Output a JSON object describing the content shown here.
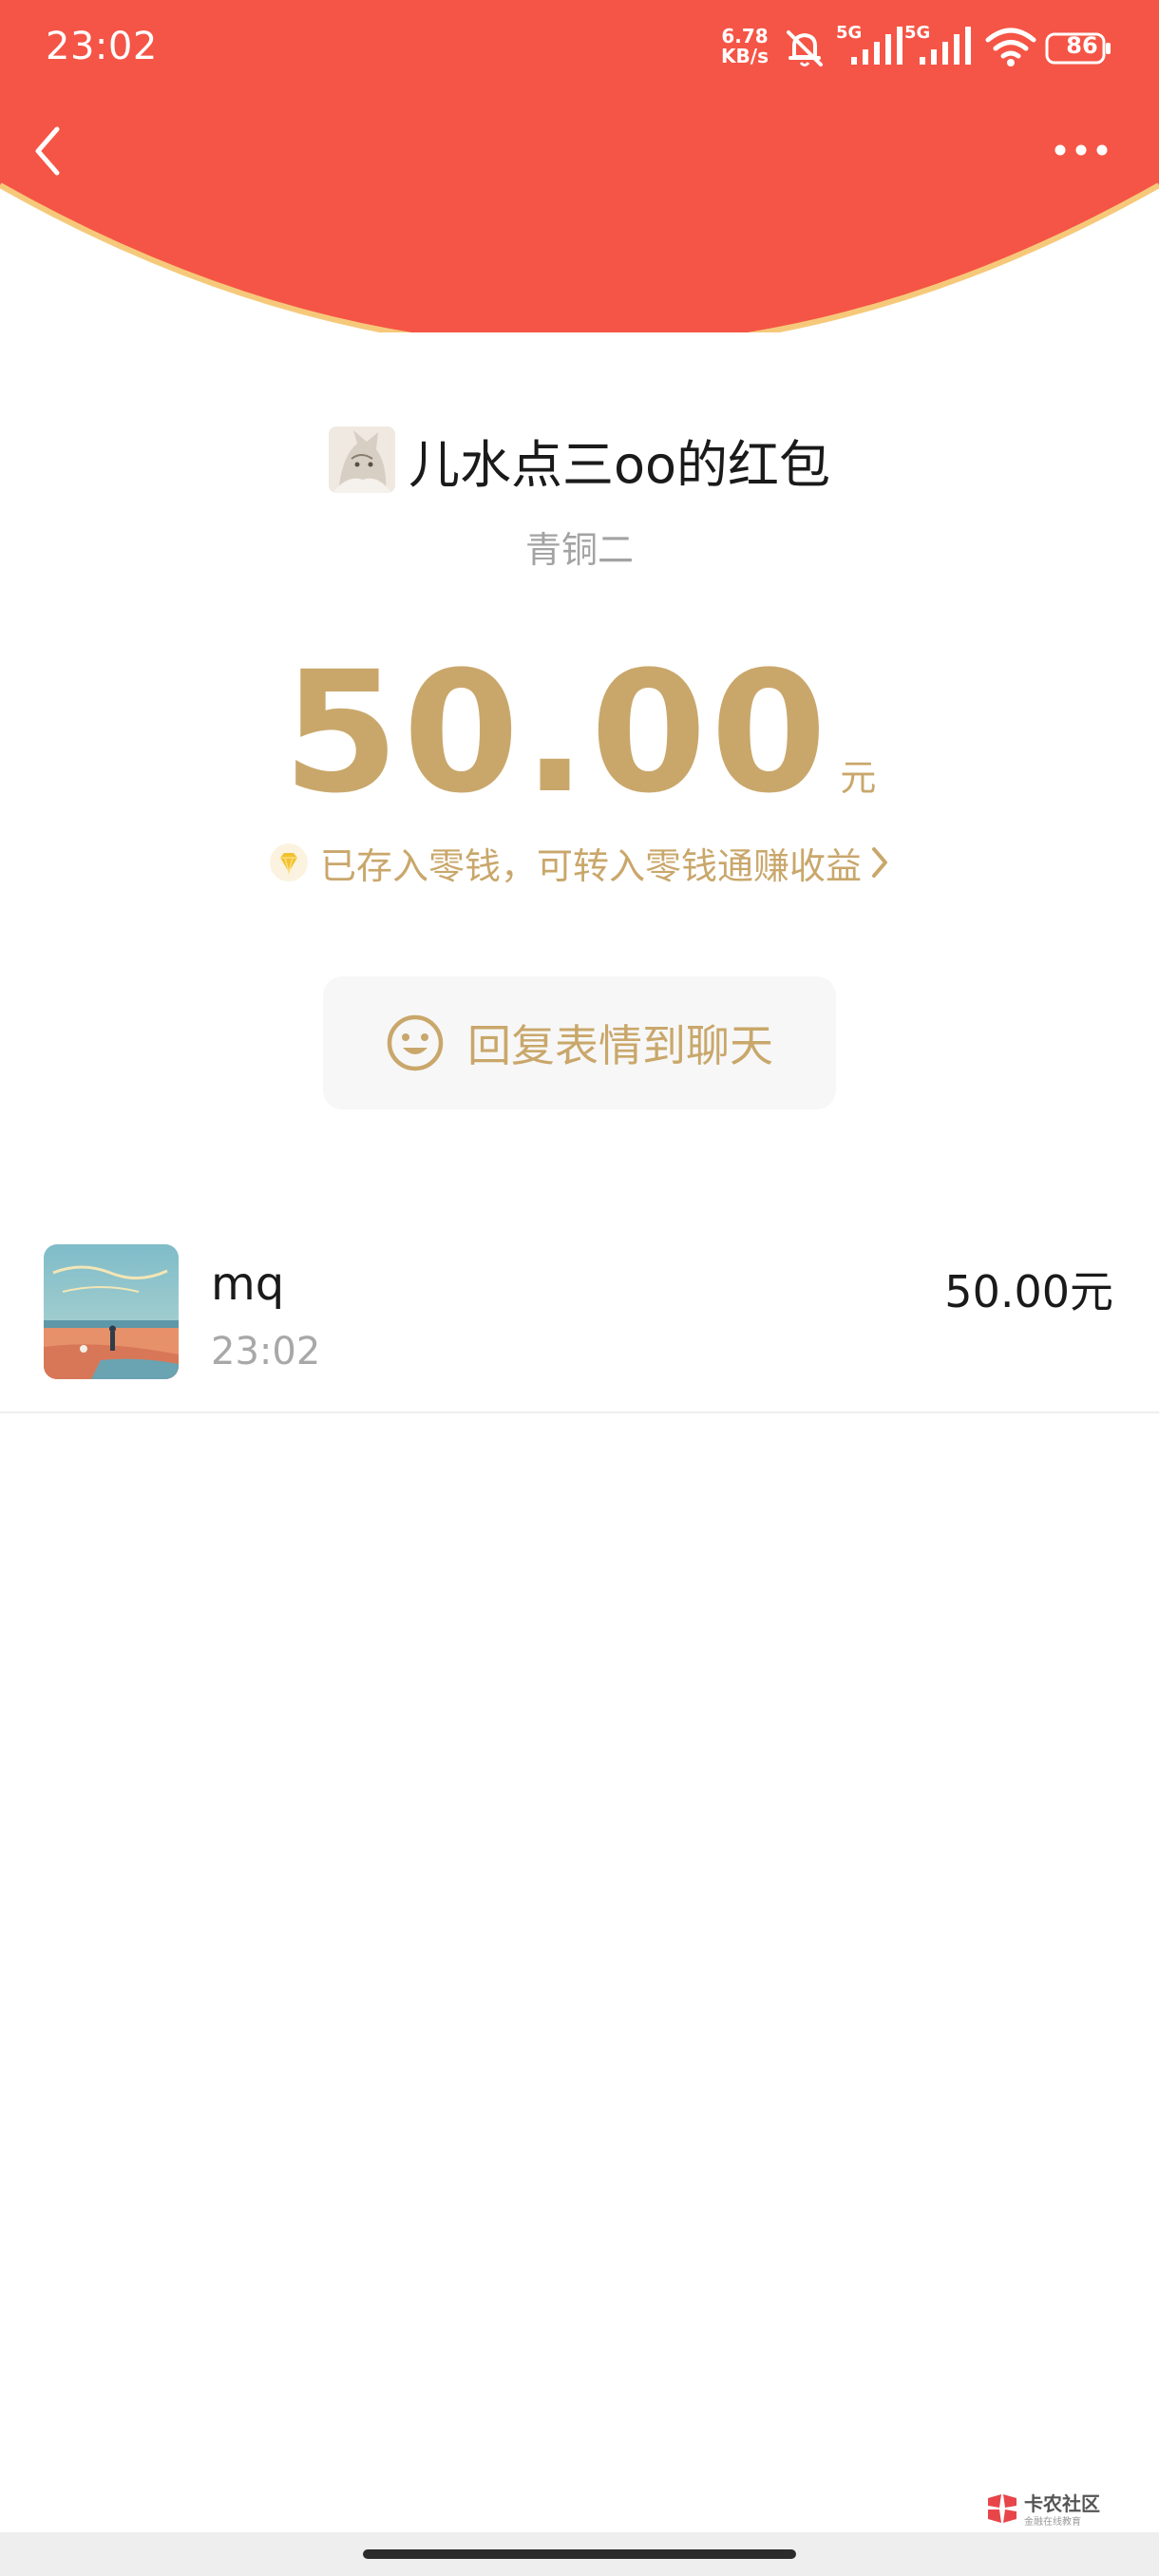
{
  "status_bar": {
    "time": "23:02",
    "net_speed_value": "6.78",
    "net_speed_unit": "KB/s",
    "signal_1_label": "5G",
    "signal_2_label": "5G",
    "battery": "86",
    "icons": [
      "mute-icon",
      "signal-icon",
      "wifi-icon",
      "battery-icon"
    ]
  },
  "nav": {
    "back_icon": "chevron-left-icon",
    "more_icon": "more-dots-icon"
  },
  "envelope": {
    "sender_title": "儿水点三oo的红包",
    "sender_subtitle": "青铜二",
    "amount": "50.00",
    "amount_unit": "元",
    "notice": "已存入零钱，可转入零钱通赚收益",
    "reply_label": "回复表情到聊天"
  },
  "receivers": [
    {
      "name": "mq",
      "time": "23:02",
      "amount": "50.00元"
    }
  ],
  "watermark": {
    "text": "卡农社区",
    "subtext": "金融在线教育"
  },
  "colors": {
    "header_red": "#f55546",
    "header_border": "#f6c97a",
    "gold": "#c9a76b",
    "text_dark": "#1a1a1a",
    "text_gray": "#a3a3a3"
  }
}
